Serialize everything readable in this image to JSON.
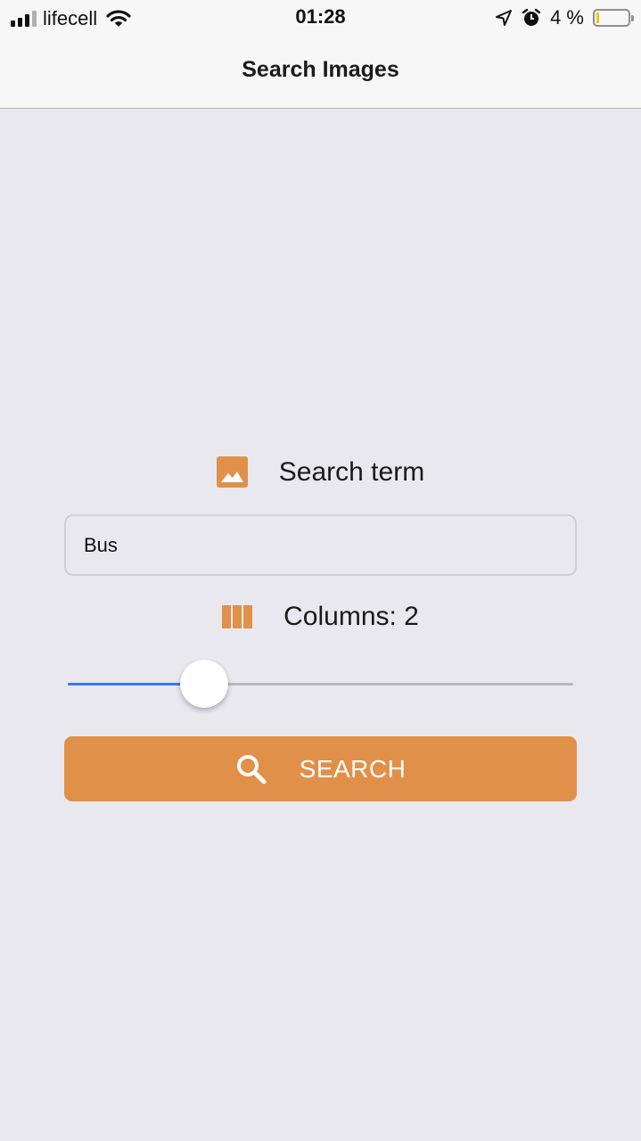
{
  "status_bar": {
    "carrier": "lifecell",
    "time": "01:28",
    "battery_text": "4 %",
    "battery_level": 0.04,
    "icons": [
      "signal-icon",
      "wifi-icon",
      "location-arrow-icon",
      "alarm-clock-icon",
      "battery-icon"
    ]
  },
  "nav": {
    "title": "Search Images"
  },
  "form": {
    "search_label": "Search term",
    "search_label_icon": "image-icon",
    "search_value": "Bus",
    "columns_label": "Columns: 2",
    "columns_label_icon": "columns-icon",
    "columns_slider_level": 0.27,
    "search_button_label": "SEARCH",
    "search_button_icon": "search-icon"
  },
  "colors": {
    "accent": "#e1904a",
    "slider_active": "#3478f6",
    "background": "#e9e8ef",
    "bar_background": "#f7f7f7"
  }
}
